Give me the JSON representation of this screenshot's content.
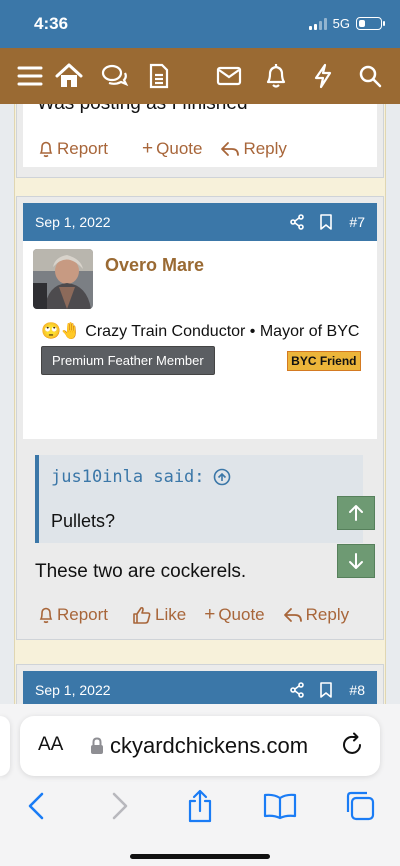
{
  "status": {
    "time": "4:36",
    "network": "5G",
    "battery_level": 0.3
  },
  "nav": {
    "icons": [
      "menu-icon",
      "home-icon",
      "forums-chat-icon",
      "document-icon",
      "mail-icon",
      "bell-icon",
      "lightning-icon",
      "search-icon"
    ]
  },
  "prev_post": {
    "text_fragment": "Was posting as I finished",
    "actions": {
      "report": "Report",
      "quote": "Quote",
      "reply": "Reply"
    }
  },
  "post7": {
    "date": "Sep 1, 2022",
    "number": "#7",
    "username": "Overo Mare",
    "title_emojis": "🙄🤚",
    "user_title": "Crazy Train Conductor • Mayor of BYC",
    "badge": "Premium Feather Member",
    "friend": "BYC Friend",
    "quote_author": "jus10inla said:",
    "quote_text": "Pullets?",
    "body": "These two are cockerels.",
    "actions": {
      "report": "Report",
      "like": "Like",
      "quote": "Quote",
      "reply": "Reply"
    }
  },
  "post8": {
    "date": "Sep 1, 2022",
    "number": "#8"
  },
  "browser": {
    "aa": "AA",
    "url": "ckyardchickens.com"
  },
  "colors": {
    "blue": "#3b77a8",
    "brown": "#9a6a33",
    "action": "#a8663a",
    "green": "#6e9a73"
  }
}
